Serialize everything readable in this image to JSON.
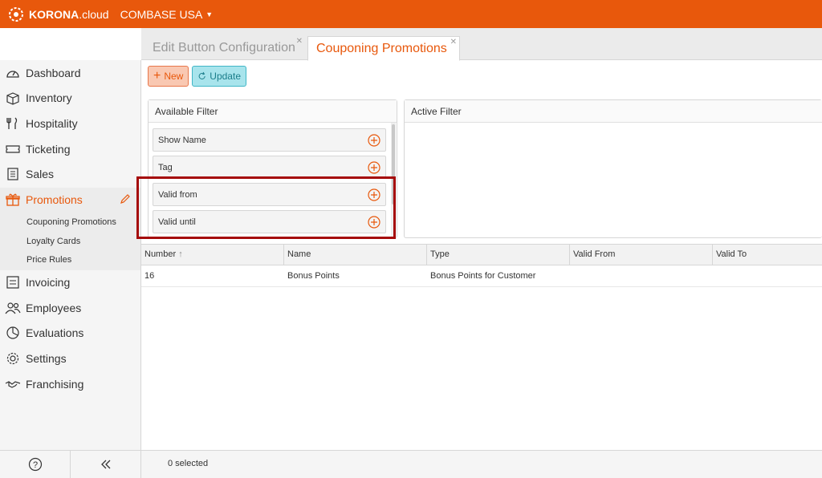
{
  "brand": {
    "logo_bold": "KORONA",
    "logo_rest": ".cloud",
    "tenant": "COMBASE USA",
    "accent": "#e8580c"
  },
  "tabs": [
    {
      "label": "Edit Button Configuration",
      "active": false
    },
    {
      "label": "Couponing Promotions",
      "active": true
    }
  ],
  "sidebar": {
    "items": [
      {
        "label": "Dashboard",
        "icon": "dashboard-icon"
      },
      {
        "label": "Inventory",
        "icon": "box-icon"
      },
      {
        "label": "Hospitality",
        "icon": "cutlery-icon"
      },
      {
        "label": "Ticketing",
        "icon": "ticket-icon"
      },
      {
        "label": "Sales",
        "icon": "receipt-icon"
      },
      {
        "label": "Promotions",
        "icon": "gift-icon",
        "active": true
      },
      {
        "label": "Invoicing",
        "icon": "invoice-icon"
      },
      {
        "label": "Employees",
        "icon": "people-icon"
      },
      {
        "label": "Evaluations",
        "icon": "pie-chart-icon"
      },
      {
        "label": "Settings",
        "icon": "gear-icon"
      },
      {
        "label": "Franchising",
        "icon": "handshake-icon"
      }
    ],
    "sub_items": [
      "Couponing Promotions",
      "Loyalty Cards",
      "Price Rules"
    ]
  },
  "toolbar": {
    "new_label": "New",
    "update_label": "Update"
  },
  "filters": {
    "available_title": "Available Filter",
    "active_title": "Active Filter",
    "available": [
      "Show Name",
      "Tag",
      "Valid from",
      "Valid until"
    ]
  },
  "table": {
    "columns": [
      "Number",
      "Name",
      "Type",
      "Valid From",
      "Valid To"
    ],
    "rows": [
      [
        "16",
        "Bonus Points",
        "Bonus Points for Customer",
        "",
        ""
      ]
    ]
  },
  "status": {
    "selected": "0 selected"
  }
}
